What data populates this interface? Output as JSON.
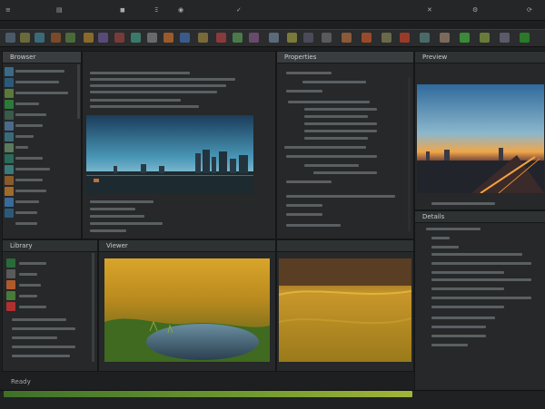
{
  "menu": {
    "items": [
      "≡",
      "▤",
      "◼",
      "Ξ",
      "◉",
      "✓",
      "✕",
      "⚙",
      "⟳"
    ]
  },
  "panels": {
    "left": {
      "title": "Browser"
    },
    "middle_top": {
      "title": "Properties"
    },
    "right_top": {
      "title": "Preview"
    },
    "mid_left_bottom": {
      "title": "Library"
    },
    "viewer_a": {
      "title": "Viewer"
    },
    "right_bottom": {
      "title": "Details"
    },
    "status": {
      "text": "Ready"
    }
  },
  "colors": {
    "accent_green": "#6f9a2f",
    "header_bg": "#3a3d3f",
    "panel_bg": "#262829"
  }
}
